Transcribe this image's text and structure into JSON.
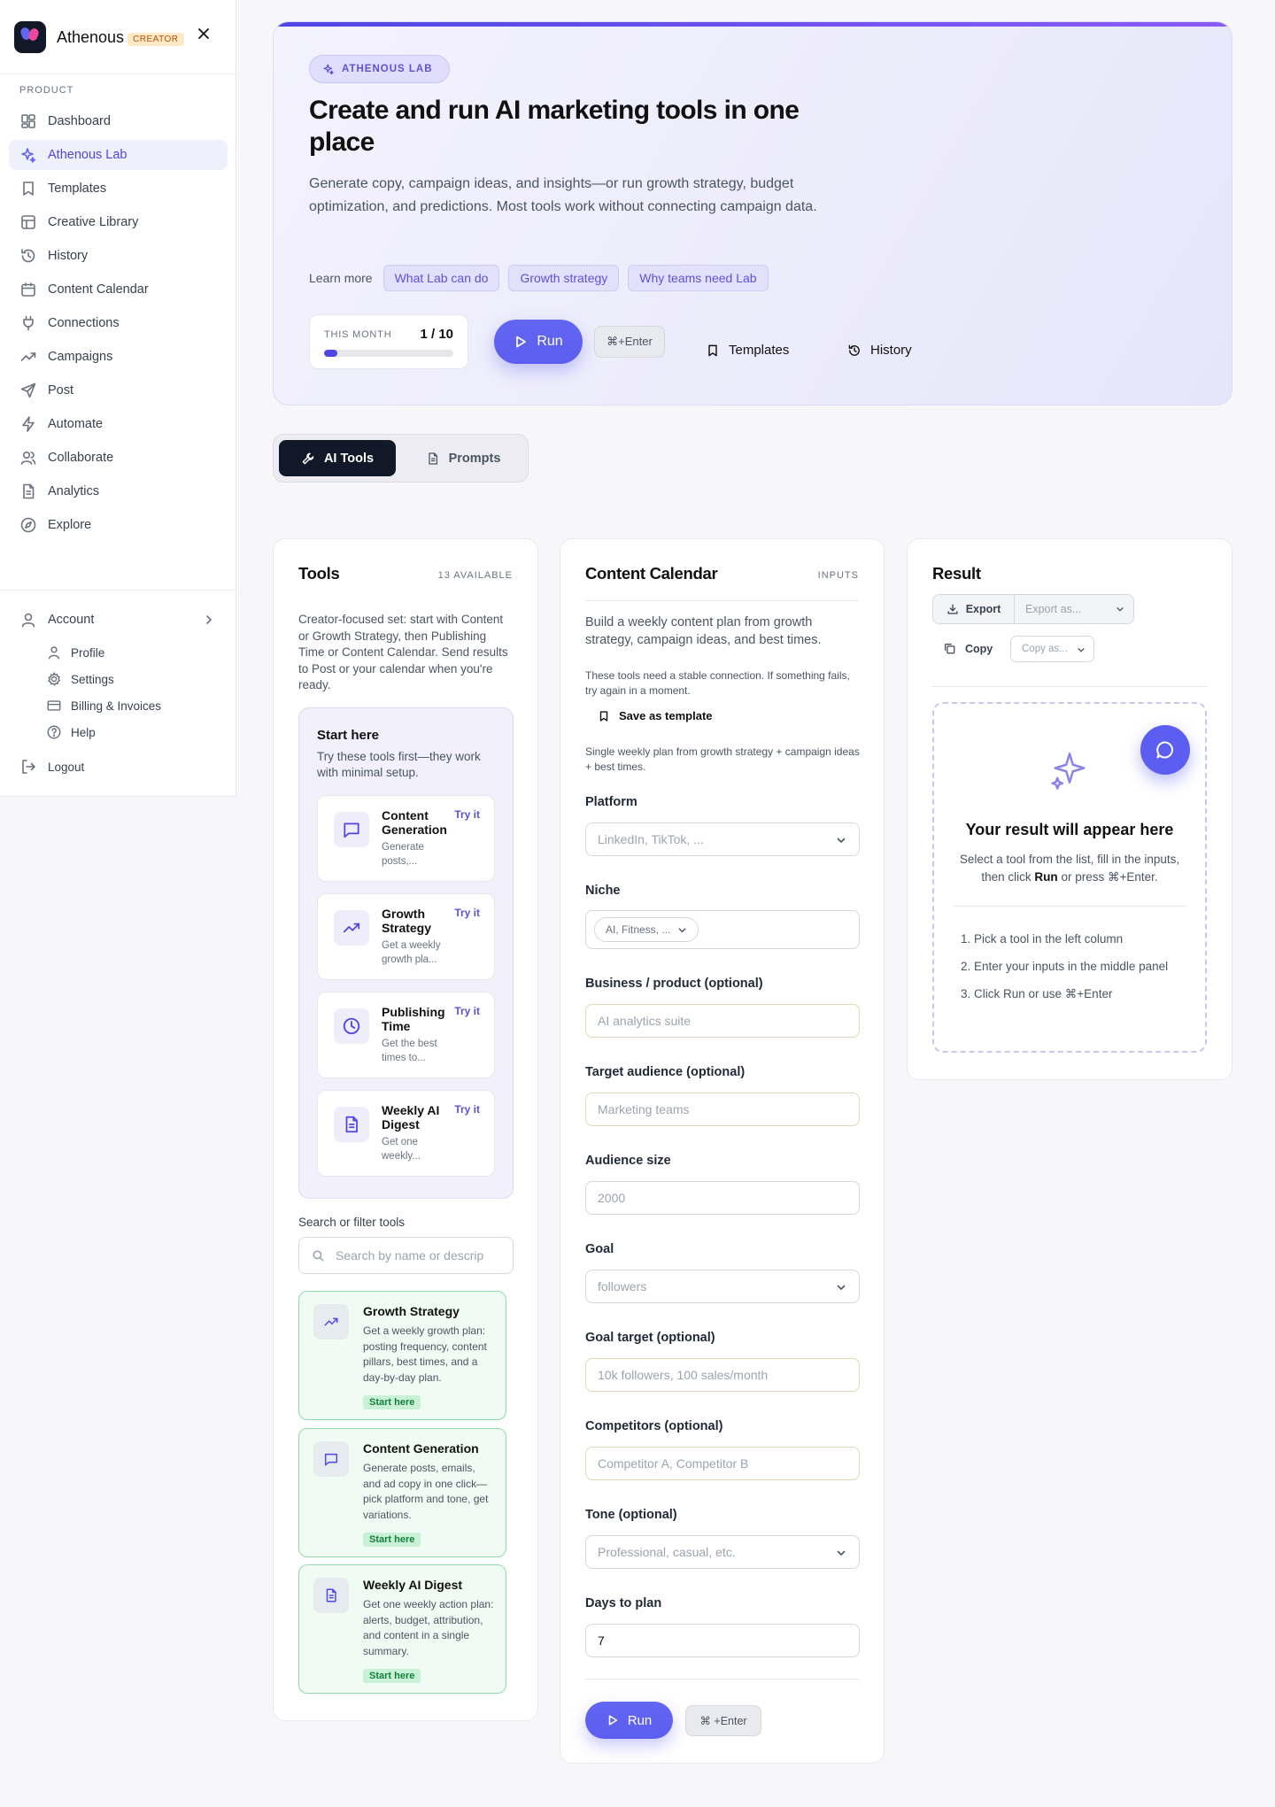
{
  "brand": {
    "name": "Athenous",
    "badge": "CREATOR"
  },
  "sidebar": {
    "section_label": "PRODUCT",
    "items": [
      {
        "label": "Dashboard",
        "icon": "dashboard-icon"
      },
      {
        "label": "Athenous Lab",
        "icon": "sparkles-icon",
        "active": true
      },
      {
        "label": "Templates",
        "icon": "bookmark-icon"
      },
      {
        "label": "Creative Library",
        "icon": "layout-icon"
      },
      {
        "label": "History",
        "icon": "history-icon"
      },
      {
        "label": "Content Calendar",
        "icon": "calendar-icon"
      },
      {
        "label": "Connections",
        "icon": "plug-icon"
      },
      {
        "label": "Campaigns",
        "icon": "trending-up-icon"
      },
      {
        "label": "Post",
        "icon": "send-icon"
      },
      {
        "label": "Automate",
        "icon": "zap-icon"
      },
      {
        "label": "Collaborate",
        "icon": "users-icon"
      },
      {
        "label": "Analytics",
        "icon": "file-chart-icon"
      },
      {
        "label": "Explore",
        "icon": "compass-icon"
      }
    ],
    "account": {
      "label": "Account",
      "sub": [
        {
          "label": "Profile",
          "icon": "user-icon"
        },
        {
          "label": "Settings",
          "icon": "gear-icon"
        },
        {
          "label": "Billing & Invoices",
          "icon": "credit-card-icon"
        },
        {
          "label": "Help",
          "icon": "help-circle-icon"
        }
      ]
    },
    "logout": "Logout"
  },
  "hero": {
    "badge": "ATHENOUS LAB",
    "title": "Create and run AI marketing tools in one place",
    "description": "Generate copy, campaign ideas, and insights—or run growth strategy, budget optimization, and predictions. Most tools work without connecting campaign data.",
    "learn_label": "Learn more",
    "learn_links": [
      "What Lab can do",
      "Growth strategy",
      "Why teams need Lab"
    ],
    "usage": {
      "label": "THIS MONTH",
      "value": "1 / 10",
      "progress": 0.1
    },
    "run_label": "Run",
    "shortcut": "⌘+Enter",
    "templates_label": "Templates",
    "history_label": "History"
  },
  "tabs": [
    {
      "label": "AI Tools",
      "active": true
    },
    {
      "label": "Prompts",
      "active": false
    }
  ],
  "tools": {
    "title": "Tools",
    "count": "13 AVAILABLE",
    "description": "Creator-focused set: start with Content or Growth Strategy, then Publishing Time or Content Calendar. Send results to Post or your calendar when you're ready.",
    "start_here": {
      "title": "Start here",
      "subtitle": "Try these tools first—they work with minimal setup.",
      "cards": [
        {
          "name": "Content Generation",
          "desc": "Generate posts,...",
          "try": "Try it",
          "icon": "message-square-icon"
        },
        {
          "name": "Growth Strategy",
          "desc": "Get a weekly growth pla...",
          "try": "Try it",
          "icon": "trending-up-icon"
        },
        {
          "name": "Publishing Time",
          "desc": "Get the best times to...",
          "try": "Try it",
          "icon": "clock-icon"
        },
        {
          "name": "Weekly AI Digest",
          "desc": "Get one weekly...",
          "try": "Try it",
          "icon": "file-text-icon"
        }
      ]
    },
    "search_label": "Search or filter tools",
    "search_placeholder": "Search by name or descrip",
    "list": [
      {
        "name": "Growth Strategy",
        "desc": "Get a weekly growth plan: posting frequency, content pillars, best times, and a day-by-day plan.",
        "tag": "Start here",
        "icon": "trending-up-icon"
      },
      {
        "name": "Content Generation",
        "desc": "Generate posts, emails, and ad copy in one click—pick platform and tone, get variations.",
        "tag": "Start here",
        "icon": "message-square-icon"
      },
      {
        "name": "Weekly AI Digest",
        "desc": "Get one weekly action plan: alerts, budget, attribution, and content in a single summary.",
        "tag": "Start here",
        "icon": "file-text-icon"
      }
    ]
  },
  "inputs": {
    "title": "Content Calendar",
    "meta": "INPUTS",
    "description": "Build a weekly content plan from growth strategy, campaign ideas, and best times.",
    "notice": "These tools need a stable connection. If something fails, try again in a moment.",
    "save_template": "Save as template",
    "summary": "Single weekly plan from growth strategy + campaign ideas + best times.",
    "fields": {
      "platform": {
        "label": "Platform",
        "placeholder": "LinkedIn, TikTok, ..."
      },
      "niche": {
        "label": "Niche",
        "placeholder": "AI, Fitness, ..."
      },
      "business": {
        "label": "Business / product (optional)",
        "placeholder": "AI analytics suite"
      },
      "audience": {
        "label": "Target audience (optional)",
        "placeholder": "Marketing teams"
      },
      "audience_size": {
        "label": "Audience size",
        "placeholder": "2000"
      },
      "goal": {
        "label": "Goal",
        "placeholder": "followers"
      },
      "goal_target": {
        "label": "Goal target (optional)",
        "placeholder": "10k followers, 100 sales/month"
      },
      "competitors": {
        "label": "Competitors (optional)",
        "placeholder": "Competitor A, Competitor B"
      },
      "tone": {
        "label": "Tone (optional)",
        "placeholder": "Professional, casual, etc."
      },
      "days": {
        "label": "Days to plan",
        "value": "7"
      }
    },
    "run_label": "Run",
    "shortcut": "⌘ +Enter"
  },
  "result": {
    "title": "Result",
    "export_label": "Export",
    "export_placeholder": "Export as...",
    "copy_label": "Copy",
    "copy_placeholder": "Copy as...",
    "empty_title": "Your result will appear here",
    "empty_sub_1": "Select a tool from the list, fill in the inputs, then click",
    "empty_sub_bold": "Run",
    "empty_sub_2": "or press ⌘+Enter.",
    "steps": [
      "1. Pick a tool in the left column",
      "2. Enter your inputs in the middle panel",
      "3. Click Run or use ⌘+Enter"
    ]
  },
  "colors": {
    "accent": "#5b5ef0",
    "dark": "#111827",
    "success_bg": "#effbf3"
  }
}
